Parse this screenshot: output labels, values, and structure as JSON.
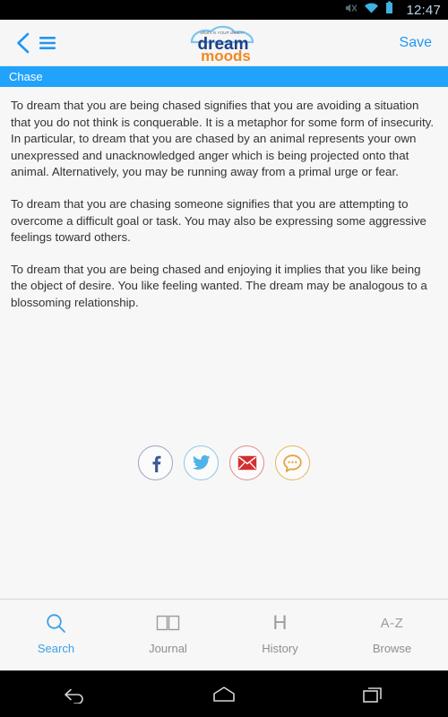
{
  "status_bar": {
    "time": "12:47",
    "icons": [
      "mute-icon",
      "wifi-icon",
      "battery-icon"
    ]
  },
  "header": {
    "back_icon": "chevron-left-icon",
    "menu_icon": "hamburger-menu-icon",
    "save_label": "Save",
    "logo": {
      "tagline": "what's in YOUR dream?",
      "line1": "dream",
      "line2": "moods",
      "cloud_color": "#7fc6ef",
      "line1_color": "#1f3f87",
      "line2_color": "#f08a22"
    }
  },
  "title_bar": {
    "text": "Chase",
    "background": "#21a2fb",
    "text_color": "#ffffff"
  },
  "content": {
    "paragraphs": [
      "To dream that you are being chased signifies that you are avoiding a situation that you do not think is conquerable. It is a metaphor for some form of insecurity. In particular, to dream that you are chased by an animal represents your own unexpressed and unacknowledged anger which is being projected onto that animal. Alternatively, you may be running away from a primal urge or fear.",
      "To dream that you are chasing someone signifies that you are attempting to overcome a difficult goal or task. You may also be expressing some aggressive feelings toward others.",
      "To dream that you are being chased and enjoying it implies that you like being the object of desire. You like feeling wanted. The dream may be analogous to a blossoming relationship."
    ]
  },
  "share": {
    "buttons": [
      {
        "name": "facebook-share-button",
        "icon": "facebook-icon",
        "color": "#3b5998",
        "ring": "#9aa6bd"
      },
      {
        "name": "twitter-share-button",
        "icon": "twitter-icon",
        "color": "#4fb3e8",
        "ring": "#8dc7e8"
      },
      {
        "name": "email-share-button",
        "icon": "envelope-icon",
        "color": "#d32f2f",
        "ring": "#e08d8d"
      },
      {
        "name": "sms-share-button",
        "icon": "chat-bubble-icon",
        "color": "#e8a33d",
        "ring": "#e8b263"
      }
    ]
  },
  "tab_bar": {
    "active_color": "#3aa0e8",
    "inactive_color": "#8e8e8e",
    "tabs": [
      {
        "label": "Search",
        "icon": "magnifier-icon",
        "active": true
      },
      {
        "label": "Journal",
        "icon": "open-book-icon",
        "active": false
      },
      {
        "label": "History",
        "icon": "h-letter-icon",
        "active": false
      },
      {
        "label": "Browse",
        "icon": "a-z-icon",
        "active": false
      }
    ]
  },
  "system_nav": {
    "back_icon": "android-back-icon",
    "home_icon": "android-home-icon",
    "recents_icon": "android-recents-icon"
  }
}
